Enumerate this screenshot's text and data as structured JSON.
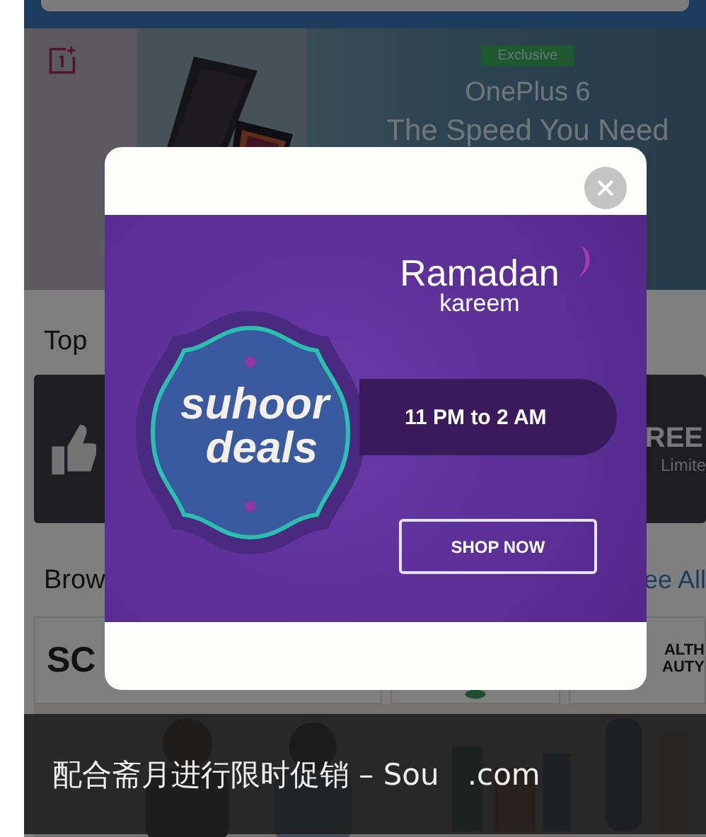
{
  "banner": {
    "tag": "Exclusive",
    "title": "OnePlus 6",
    "subtitle": "The Speed You Need"
  },
  "section_heading": "Top",
  "offer_card": {
    "title": "REE",
    "subtitle": "Limite"
  },
  "browse": {
    "heading": "Brow",
    "link": "ee All"
  },
  "brand_tiles": [
    {
      "kind": "text",
      "lines": [
        "SC"
      ]
    },
    {
      "kind": "picture"
    },
    {
      "kind": "text",
      "lines": [
        "ALTH",
        "AUTY"
      ]
    }
  ],
  "popup": {
    "title": "Ramadan",
    "subtitle": "kareem",
    "badge_lines": [
      "suhoor",
      "deals"
    ],
    "time": "11 PM to 2 AM",
    "button": "SHOP NOW"
  },
  "caption": "配合斋月进行限时促销 – Sou   .com"
}
